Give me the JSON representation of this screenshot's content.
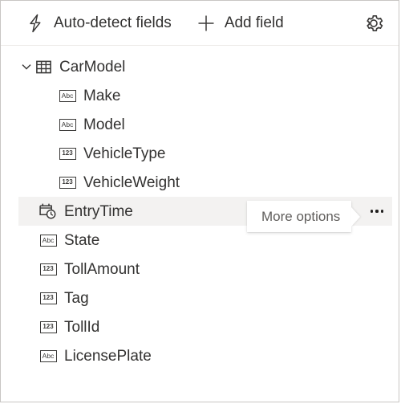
{
  "toolbar": {
    "auto_detect": {
      "label": "Auto-detect fields",
      "icon": "lightning-bolt-icon"
    },
    "add_field": {
      "label": "Add field",
      "icon": "plus-icon"
    },
    "settings": {
      "icon": "gear-icon"
    }
  },
  "tree": {
    "root": {
      "label": "CarModel",
      "icon": "table-icon",
      "expanded": true,
      "chevron": "chevron-down-icon"
    },
    "nodes": [
      {
        "label": "Make",
        "icon": "abc-icon",
        "type": "Abc",
        "depth": 2,
        "selected": false
      },
      {
        "label": "Model",
        "icon": "abc-icon",
        "type": "Abc",
        "depth": 2,
        "selected": false
      },
      {
        "label": "VehicleType",
        "icon": "number-icon",
        "type": "123",
        "depth": 2,
        "selected": false
      },
      {
        "label": "VehicleWeight",
        "icon": "number-icon",
        "type": "123",
        "depth": 2,
        "selected": false
      },
      {
        "label": "EntryTime",
        "icon": "date-time-icon",
        "type": "datetime",
        "depth": 1,
        "selected": true
      },
      {
        "label": "State",
        "icon": "abc-icon",
        "type": "Abc",
        "depth": 1,
        "selected": false
      },
      {
        "label": "TollAmount",
        "icon": "number-icon",
        "type": "123",
        "depth": 1,
        "selected": false
      },
      {
        "label": "Tag",
        "icon": "number-icon",
        "type": "123",
        "depth": 1,
        "selected": false
      },
      {
        "label": "TollId",
        "icon": "number-icon",
        "type": "123",
        "depth": 1,
        "selected": false
      },
      {
        "label": "LicensePlate",
        "icon": "abc-icon",
        "type": "Abc",
        "depth": 1,
        "selected": false
      }
    ]
  },
  "tooltip": {
    "text": "More options",
    "attached_to": "EntryTime"
  },
  "more_options_button": {
    "icon": "ellipsis-icon",
    "aria_label": "More options"
  },
  "colors": {
    "text": "#323130",
    "icon": "#3b3a39",
    "selected_row_bg": "#f3f2f1",
    "panel_border": "#c8c6c4",
    "divider": "#edebe9",
    "tooltip_text": "#605e5c",
    "surface": "#ffffff"
  }
}
